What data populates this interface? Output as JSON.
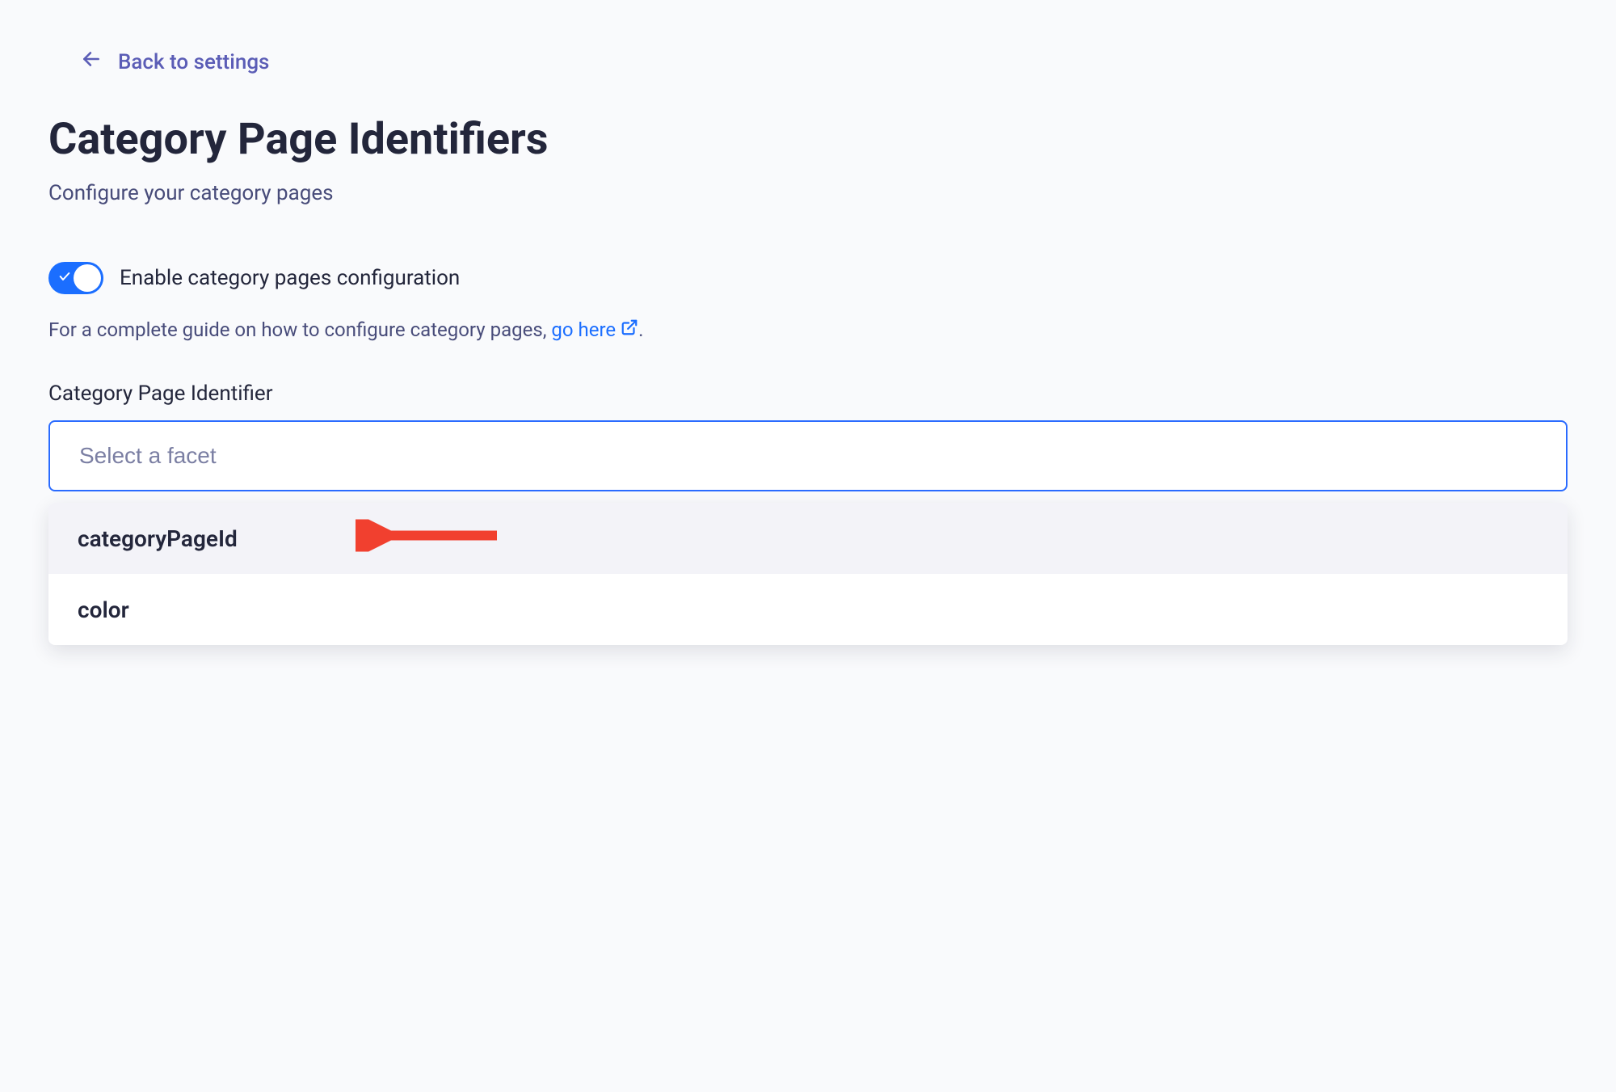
{
  "back": {
    "label": "Back to settings"
  },
  "header": {
    "title": "Category Page Identifiers",
    "subtitle": "Configure your category pages"
  },
  "toggle": {
    "label": "Enable category pages configuration",
    "enabled": true
  },
  "help": {
    "text_prefix": "For a complete guide on how to configure category pages, ",
    "link_label": "go here",
    "text_suffix": "."
  },
  "facet": {
    "label": "Category Page Identifier",
    "placeholder": "Select a facet",
    "options": [
      {
        "label": "categoryPageId",
        "highlighted": true
      },
      {
        "label": "color",
        "highlighted": false
      }
    ]
  }
}
